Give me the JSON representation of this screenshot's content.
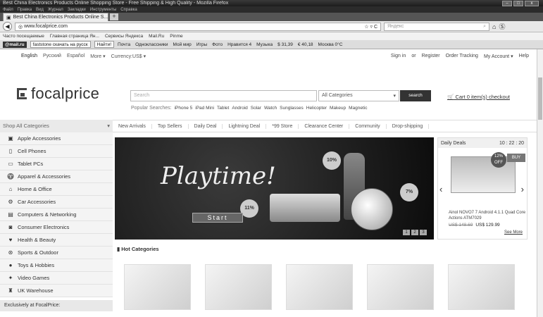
{
  "browser": {
    "window_title": "Best China Electronics Products Online Shopping Store - Free Shipping & High Quality - Mozilla Firefox",
    "menu": [
      "Файл",
      "Правка",
      "Вид",
      "Журнал",
      "Закладки",
      "Инструменты",
      "Справка"
    ],
    "tab_title": "Best China Electronics Products Online S...",
    "new_tab": "+",
    "url": "www.focalprice.com",
    "search_placeholder": "Яндекс",
    "bookmarks": [
      "Часто посещаемые",
      "Главная страница Ян...",
      "Сервисы Яндекса",
      "Mail.Ru",
      "Pinme"
    ],
    "mailru_toolbar": {
      "logo": "@mail.ru",
      "search_value": "faststone скачать на русск",
      "find": "Найти!",
      "items": [
        "Почта",
        "Одноклассники",
        "Мой мир",
        "Игры",
        "Фото",
        "Нравится 4",
        "Музыка",
        "$ 31,39",
        "€ 40,18",
        "Москва 0°C"
      ]
    }
  },
  "site": {
    "languages": [
      "English",
      "Русский",
      "Español",
      "More ▾",
      "Currency:US$ ▾"
    ],
    "top_links": [
      "Sign in",
      "or",
      "Register",
      "Order Tracking",
      "My Account ▾",
      "Help"
    ],
    "logo_text": "focalprice",
    "search_placeholder": "Search",
    "category_select": "All Categories",
    "search_button": "search",
    "cart": "Cart 0 item(s) checkout",
    "popular_label": "Popular Searches:",
    "popular": [
      "iPhone 5",
      "iPad Mini",
      "Tablet",
      "Android",
      "Solar",
      "Watch",
      "Sunglasses",
      "Helicopter",
      "Makeup",
      "Magnetic"
    ],
    "shop_all": "Shop All Categories",
    "nav": [
      "New Arrivals",
      "Top Sellers",
      "Daily Deal",
      "Lightning Deal",
      "*99 Store",
      "Clearance Center",
      "Community",
      "Drop-shipping"
    ],
    "categories": [
      {
        "label": "Apple Accessories",
        "icon": "apple-icon",
        "glyph": "▣"
      },
      {
        "label": "Cell Phones",
        "icon": "phone-icon",
        "glyph": "▯"
      },
      {
        "label": "Tablet PCs",
        "icon": "tablet-icon",
        "glyph": "▭"
      },
      {
        "label": "Apparel & Accessories",
        "icon": "shirt-icon",
        "glyph": "♈"
      },
      {
        "label": "Home & Office",
        "icon": "home-icon",
        "glyph": "⌂"
      },
      {
        "label": "Car Accessories",
        "icon": "car-icon",
        "glyph": "⚙"
      },
      {
        "label": "Computers & Networking",
        "icon": "computer-icon",
        "glyph": "▤"
      },
      {
        "label": "Consumer Electronics",
        "icon": "camera-icon",
        "glyph": "◙"
      },
      {
        "label": "Health & Beauty",
        "icon": "heart-icon",
        "glyph": "♥"
      },
      {
        "label": "Sports & Outdoor",
        "icon": "sport-icon",
        "glyph": "⊛"
      },
      {
        "label": "Toys & Hobbies",
        "icon": "toy-icon",
        "glyph": "●"
      },
      {
        "label": "Video Games",
        "icon": "gamepad-icon",
        "glyph": "✦"
      },
      {
        "label": "UK Warehouse",
        "icon": "warehouse-icon",
        "glyph": "♜"
      }
    ],
    "exclusive": "Exclusively at FocalPrice:",
    "banner": {
      "title": "Playtime!",
      "button": "Start",
      "badges": [
        "10%",
        "11%",
        "7%"
      ],
      "pages": [
        "1",
        "2",
        "3"
      ]
    },
    "daily_deals": {
      "label": "Daily Deals",
      "timer": "10 : 22 : 20",
      "badge": "12% OFF",
      "buy": "BUY",
      "title": "Ainol NOVO7 7 Android 4.1.1 Quad Core Actions ATM7029",
      "old_price": "US$ 148.69",
      "price": "US$ 129.99",
      "more": "See More"
    },
    "hot_categories": "Hot Categories"
  }
}
